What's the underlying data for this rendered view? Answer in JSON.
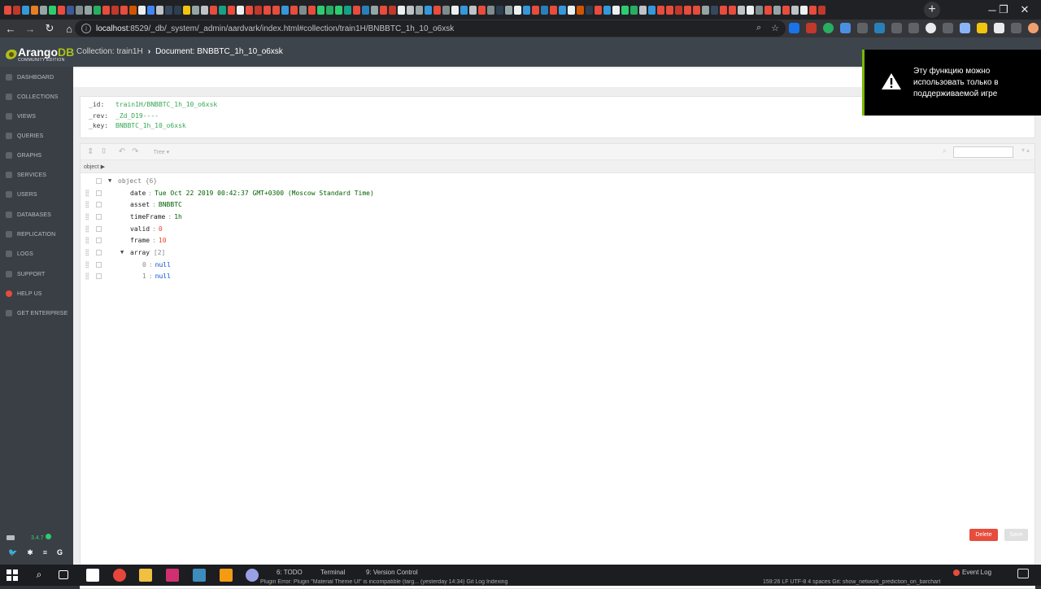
{
  "browser": {
    "address_host": "localhost",
    "address_rest": ":8529/_db/_system/_admin/aardvark/index.html#collection/train1H/BNBBTC_1h_10_o6xsk",
    "tab_favicon_colors": [
      "#e74c3c",
      "#c0392b",
      "#3498db",
      "#e67e22",
      "#95a5a6",
      "#2ecc71",
      "#e74c3c",
      "#3b5998",
      "#7f8c8d",
      "#95a5a6",
      "#27ae60",
      "#e74c3c",
      "#c0392b",
      "#e74c3c",
      "#d35400",
      "#ecf0f1",
      "#4285f4",
      "#bdc3c7",
      "#34495e",
      "#2c3e50",
      "#f1c40f",
      "#95a5a6",
      "#bdc3c7",
      "#e74c3c",
      "#16a085",
      "#e74c3c",
      "#ecf0f1",
      "#e74c3c",
      "#c0392b",
      "#e74c3c",
      "#e74c3c",
      "#3498db",
      "#e74c3c",
      "#7f8c8d",
      "#e74c3c",
      "#2ecc71",
      "#27ae60",
      "#2ecc71",
      "#16a085",
      "#e74c3c",
      "#2980b9",
      "#95a5a6",
      "#e74c3c",
      "#c0392b",
      "#ecf0f1",
      "#bdc3c7",
      "#95a5a6",
      "#3498db",
      "#e74c3c",
      "#7f8c8d",
      "#ecf0f1",
      "#3498db",
      "#bdc3c7",
      "#e74c3c",
      "#7f8c8d",
      "#2c3e50",
      "#95a5a6",
      "#ecf0f1",
      "#3498db",
      "#e74c3c",
      "#2980b9",
      "#e74c3c",
      "#3498db",
      "#ecf0f1",
      "#d35400",
      "#2c3e50",
      "#e74c3c",
      "#3498db",
      "#ecf0f1",
      "#2ecc71",
      "#27ae60",
      "#bdc3c7",
      "#3498db",
      "#e74c3c",
      "#e74c3c",
      "#c0392b",
      "#e74c3c",
      "#e74c3c",
      "#95a5a6",
      "#34495e",
      "#e74c3c",
      "#e74c3c",
      "#bdc3c7",
      "#ecf0f1",
      "#7f8c8d",
      "#e74c3c",
      "#95a5a6",
      "#e74c3c",
      "#bdc3c7",
      "#ecf0f1",
      "#e74c3c",
      "#c0392b"
    ],
    "new_tab": "+",
    "win_minimize": "─",
    "win_maximize": "❐",
    "win_close": "✕"
  },
  "arango": {
    "logo_main": "Arango",
    "logo_db": "DB",
    "logo_edition": "COMMUNITY EDITION",
    "breadcrumb_collection": "Collection: train1H",
    "breadcrumb_document": "Document: BNBBTC_1h_10_o6xsk"
  },
  "sidebar": {
    "items": [
      {
        "label": "DASHBOARD"
      },
      {
        "label": "COLLECTIONS"
      },
      {
        "label": "VIEWS"
      },
      {
        "label": "QUERIES"
      },
      {
        "label": "GRAPHS"
      },
      {
        "label": "SERVICES"
      },
      {
        "label": "USERS"
      },
      {
        "label": "DATABASES"
      },
      {
        "label": "REPLICATION"
      },
      {
        "label": "LOGS"
      },
      {
        "label": "SUPPORT"
      },
      {
        "label": "HELP US"
      },
      {
        "label": "GET ENTERPRISE"
      }
    ],
    "version": "3.4.7"
  },
  "document": {
    "id_label": "_id:",
    "id_value": "train1H/BNBBTC_1h_10_o6xsk",
    "rev_label": "_rev:",
    "rev_value": "_Zd_D19----",
    "key_label": "_key:",
    "key_value": "BNBBTC_1h_10_o6xsk"
  },
  "editor": {
    "mode": "Tree ▾",
    "nav_path": "object ▶",
    "root_label": "object",
    "root_count": "{6}",
    "fields": [
      {
        "key": "date",
        "value": "Tue Oct 22 2019 00:42:37 GMT+0300 (Moscow Standard Time)",
        "type": "str"
      },
      {
        "key": "asset",
        "value": "BNBBTC",
        "type": "str"
      },
      {
        "key": "timeFrame",
        "value": "1h",
        "type": "str"
      },
      {
        "key": "valid",
        "value": "0",
        "type": "num"
      },
      {
        "key": "frame",
        "value": "10",
        "type": "num"
      }
    ],
    "array_key": "array",
    "array_count": "[2]",
    "array_items": [
      {
        "index": "0",
        "value": "null"
      },
      {
        "index": "1",
        "value": "null"
      }
    ],
    "delete_label": "Delete",
    "save_label": "Save"
  },
  "toast": {
    "text": "Эту функцию можно использовать только в поддерживаемой игре"
  },
  "taskbar": {
    "ide_todo": "6: TODO",
    "ide_terminal": "Terminal",
    "ide_vcs": "9: Version Control",
    "event_log": "Event Log",
    "status_text": "Plugin Error: Plugin \"Material Theme UI\" is incompatible (targ... (yesterday 14:34)   Git Log Indexing",
    "status_right": "159:26   LF   UTF-8   4 spaces   Git: show_network_prediction_on_barchart"
  }
}
